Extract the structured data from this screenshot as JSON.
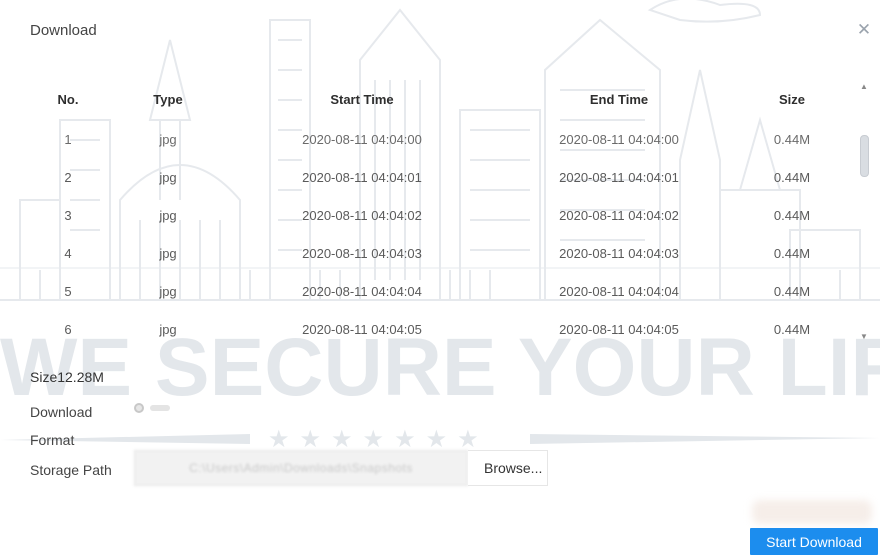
{
  "dialog": {
    "title": "Download",
    "close_icon": "close-icon"
  },
  "table": {
    "headers": {
      "no": "No.",
      "type": "Type",
      "start": "Start Time",
      "end": "End Time",
      "size": "Size"
    },
    "rows": [
      {
        "no": "1",
        "type": "jpg",
        "start": "2020-08-11 04:04:00",
        "end": "2020-08-11 04:04:00",
        "size": "0.44M"
      },
      {
        "no": "2",
        "type": "jpg",
        "start": "2020-08-11 04:04:01",
        "end": "2020-08-11 04:04:01",
        "size": "0.44M"
      },
      {
        "no": "3",
        "type": "jpg",
        "start": "2020-08-11 04:04:02",
        "end": "2020-08-11 04:04:02",
        "size": "0.44M"
      },
      {
        "no": "4",
        "type": "jpg",
        "start": "2020-08-11 04:04:03",
        "end": "2020-08-11 04:04:03",
        "size": "0.44M"
      },
      {
        "no": "5",
        "type": "jpg",
        "start": "2020-08-11 04:04:04",
        "end": "2020-08-11 04:04:04",
        "size": "0.44M"
      },
      {
        "no": "6",
        "type": "jpg",
        "start": "2020-08-11 04:04:05",
        "end": "2020-08-11 04:04:05",
        "size": "0.44M"
      }
    ]
  },
  "summary": {
    "size_text": "Size12.28M"
  },
  "form": {
    "download_label": "Download",
    "format_label": "Format",
    "storage_path_label": "Storage Path",
    "storage_path_value": "C:\\Users\\Admin\\Downloads\\Snapshots",
    "browse_label": "Browse..."
  },
  "footer": {
    "start_download_label": "Start Download"
  },
  "watermark": {
    "text": "WE SECURE YOUR LIFE"
  },
  "colors": {
    "accent": "#1c8dee",
    "watermark": "#dfe3e8"
  }
}
